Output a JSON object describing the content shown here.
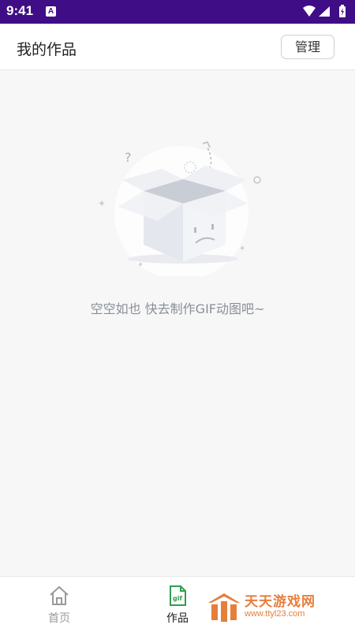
{
  "status_bar": {
    "time": "9:41",
    "notification_letter": "A"
  },
  "header": {
    "title": "我的作品",
    "manage_label": "管理"
  },
  "empty_state": {
    "message": "空空如也 快去制作GIF动图吧~"
  },
  "bottom_nav": [
    {
      "label": "首页",
      "icon": "home-icon",
      "selected": false
    },
    {
      "label": "作品",
      "icon": "gif-icon",
      "icon_text": "gif",
      "selected": true
    }
  ],
  "watermark": {
    "title": "天天游戏网",
    "url": "www.ttyl23.com"
  },
  "colors": {
    "status_bar": "#3f0d85",
    "accent_green": "#2e9e4f",
    "watermark_orange": "#e67e3b",
    "empty_text": "#8a8f99"
  }
}
